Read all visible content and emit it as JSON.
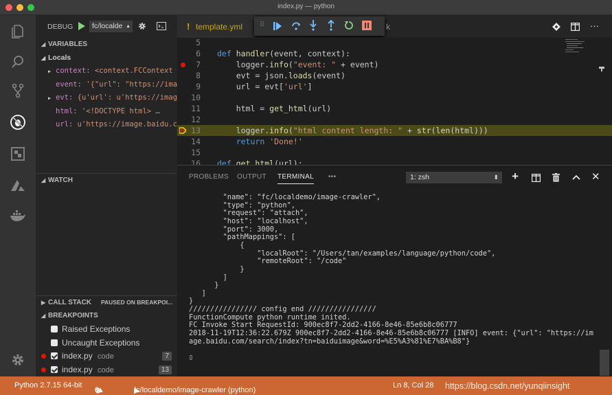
{
  "window": {
    "title": "index.py — python"
  },
  "debug": {
    "label": "DEBUG",
    "config": "fc/localde",
    "sections": {
      "variables": "VARIABLES",
      "locals": "Locals",
      "watch": "WATCH",
      "call_stack": "CALL STACK",
      "paused": "PAUSED ON BREAKPOI...",
      "breakpoints": "BREAKPOINTS"
    },
    "variables": [
      {
        "name": "context:",
        "value": "<context.FCContext i…",
        "expandable": true
      },
      {
        "name": "event:",
        "value": "'{\"url\": \"https://imag…",
        "expandable": false
      },
      {
        "name": "evt:",
        "value": "{u'url': u'https://image…",
        "expandable": true
      },
      {
        "name": "html:",
        "value": "'<!DOCTYPE html>          …",
        "expandable": false
      },
      {
        "name": "url:",
        "value": "u'https://image.baidu.co…",
        "expandable": false
      }
    ],
    "breakpoints": [
      {
        "label": "Raised Exceptions",
        "checked": false,
        "dot": false,
        "file": "",
        "line": ""
      },
      {
        "label": "Uncaught Exceptions",
        "checked": false,
        "dot": false,
        "file": "",
        "line": ""
      },
      {
        "label": "index.py",
        "checked": true,
        "dot": true,
        "file": "code",
        "line": "7"
      },
      {
        "label": "index.py",
        "checked": true,
        "dot": true,
        "file": "code",
        "line": "13"
      }
    ]
  },
  "editor": {
    "tab": {
      "prefix": "!",
      "name": "template.yml",
      "suffix": "k"
    },
    "lines": [
      {
        "num": "5",
        "code": ""
      },
      {
        "num": "6",
        "code": "def handler(event, context):"
      },
      {
        "num": "7",
        "code": "    logger.info(\"event: \" + event)",
        "breakpoint": true
      },
      {
        "num": "8",
        "code": "    evt = json.loads(event)"
      },
      {
        "num": "9",
        "code": "    url = evt['url']"
      },
      {
        "num": "10",
        "code": ""
      },
      {
        "num": "11",
        "code": "    html = get_html(url)"
      },
      {
        "num": "12",
        "code": ""
      },
      {
        "num": "13",
        "code": "    logger.info(\"html content length: \" + str(len(html)))",
        "current": true
      },
      {
        "num": "14",
        "code": "    return 'Done!'"
      },
      {
        "num": "15",
        "code": ""
      },
      {
        "num": "16",
        "code": "def get_html(url):"
      }
    ]
  },
  "panel": {
    "tabs": [
      "PROBLEMS",
      "OUTPUT",
      "TERMINAL",
      "•••"
    ],
    "active_tab": "TERMINAL",
    "terminal_select": "1: zsh",
    "terminal": [
      "        \"name\": \"fc/localdemo/image-crawler\",",
      "        \"type\": \"python\",",
      "        \"request\": \"attach\",",
      "        \"host\": \"localhost\",",
      "        \"port\": 3000,",
      "        \"pathMappings\": [",
      "            {",
      "                \"localRoot\": \"/Users/tan/examples/language/python/code\",",
      "                \"remoteRoot\": \"/code\"",
      "            }",
      "        ]",
      "      }",
      "   ]",
      "}",
      "//////////////// config end ////////////////",
      "FunctionCompute python runtime inited.",
      "FC Invoke Start RequestId: 900ec8f7-2dd2-4166-8e46-85e6b8c06777",
      "2018-11-19T12:36:22.679Z 900ec8f7-2dd2-4166-8e46-85e6b8c06777 [INFO] event: {\"url\": \"https://im",
      "age.baidu.com/search/index?tn=baiduimage&word=%E5%A3%81%E7%BA%B8\"}",
      "",
      "▯"
    ]
  },
  "status": {
    "python": "Python 2.7.15 64-bit",
    "errors": "0",
    "warnings": "0",
    "launch": "fc/localdemo/image-crawler (python)",
    "position": "Ln 8, Col 28",
    "watermark": "https://blog.csdn.net/yunqiinsight"
  },
  "colors": {
    "status_bg": "#cc6633",
    "breakpoint": "#e51400",
    "current_line": "#4b4b18",
    "keyword": "#569cd6",
    "function": "#dcdcaa",
    "string": "#ce9178"
  }
}
